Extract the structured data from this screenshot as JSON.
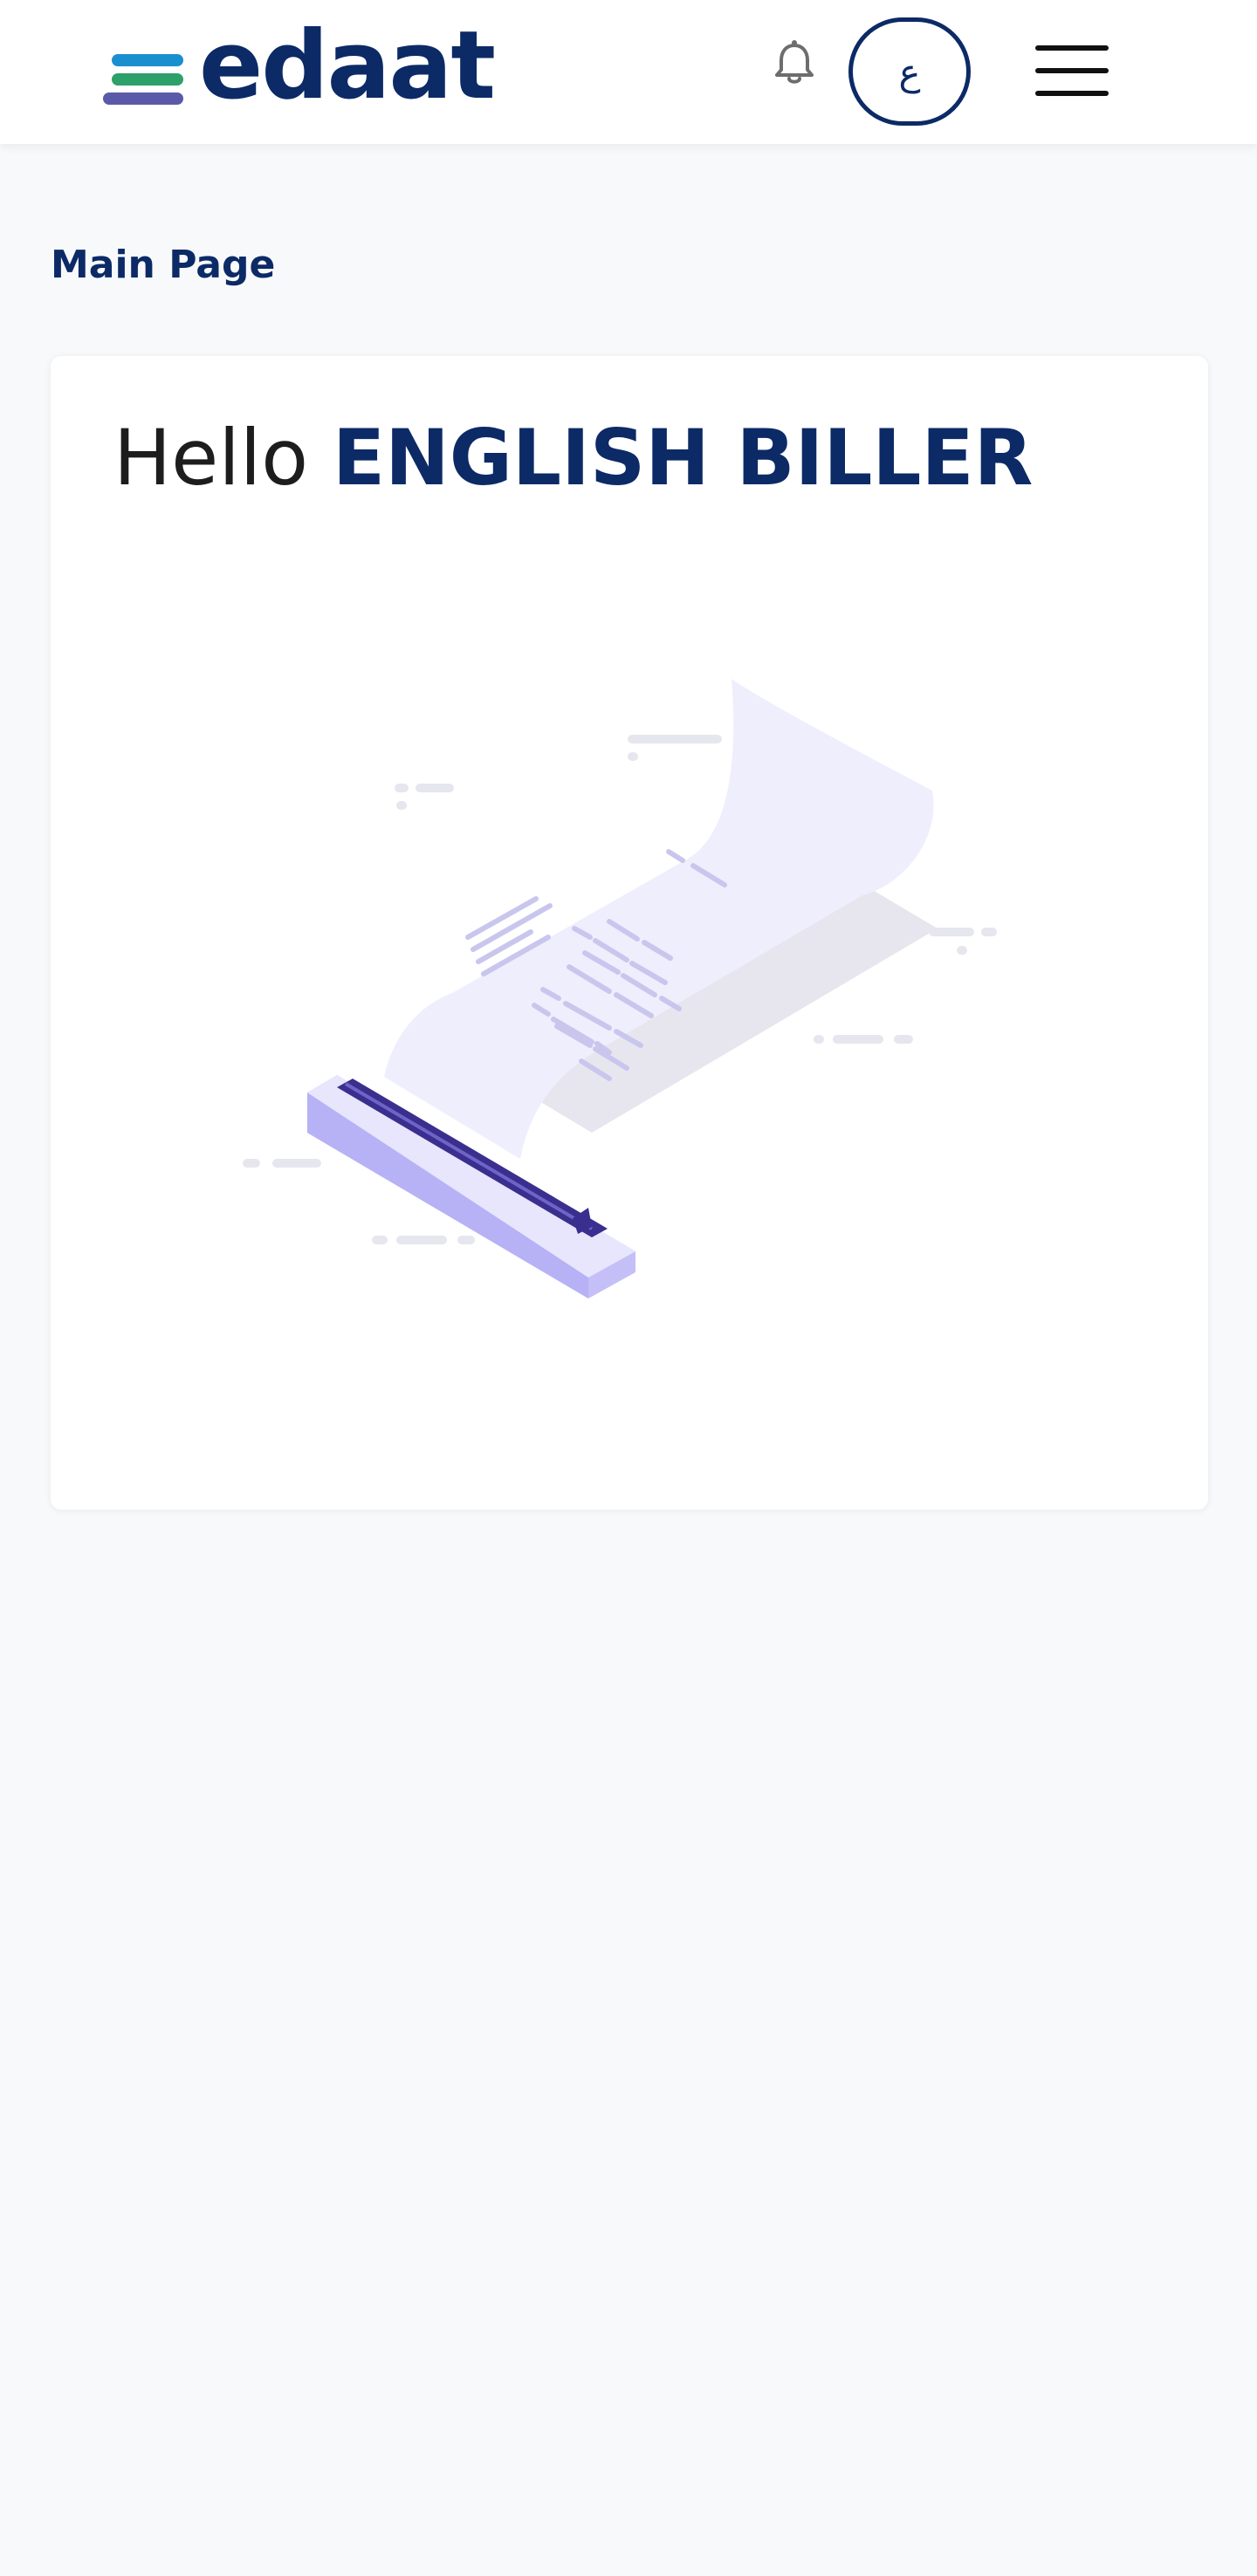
{
  "header": {
    "logo": {
      "text": "edaat",
      "registered_mark": "®",
      "text_color": "#0c2a66",
      "bar_colors": [
        "#1a8fd0",
        "#2ea06a",
        "#5b5aa8"
      ]
    },
    "notifications_icon": "bell-icon",
    "language_toggle_label": "ع",
    "menu_icon": "hamburger-menu-icon"
  },
  "breadcrumb": {
    "label": "Main Page"
  },
  "welcome_card": {
    "greeting_prefix": "Hello",
    "user_name": "ENGLISH BILLER",
    "illustration_icon": "receipt-printer-illustration"
  },
  "colors": {
    "brand_navy": "#0c2a66",
    "page_background": "#f8f9fb",
    "card_background": "#ffffff",
    "illustration_lavender": "#efeefd",
    "illustration_purple": "#c4c0f7",
    "illustration_dark_purple": "#3a2f8e"
  }
}
